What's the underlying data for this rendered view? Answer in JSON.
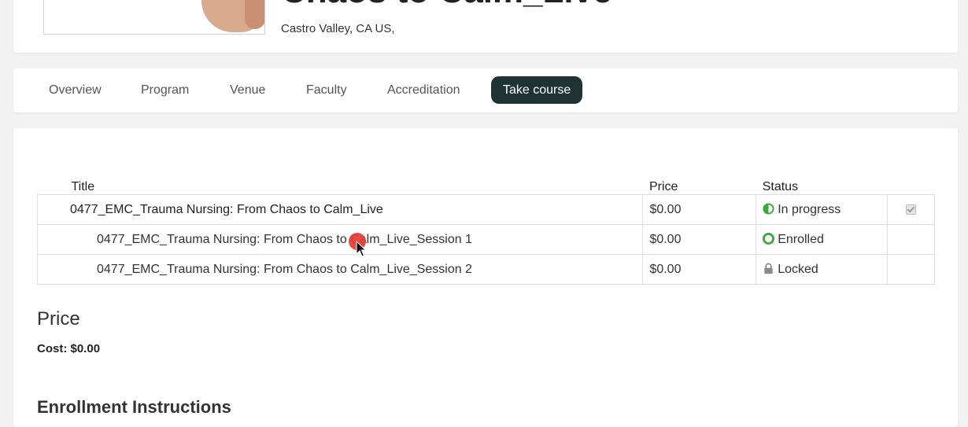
{
  "header": {
    "course_title": "Chaos to Calm_Live",
    "location": "Castro Valley, CA US,"
  },
  "tabs": [
    {
      "label": "Overview",
      "active": false
    },
    {
      "label": "Program",
      "active": false
    },
    {
      "label": "Venue",
      "active": false
    },
    {
      "label": "Faculty",
      "active": false
    },
    {
      "label": "Accreditation",
      "active": false
    },
    {
      "label": "Take course",
      "active": true
    }
  ],
  "table": {
    "headers": {
      "title": "Title",
      "price": "Price",
      "status": "Status"
    },
    "rows": [
      {
        "title": "0477_EMC_Trauma Nursing: From Chaos to Calm_Live",
        "price": "$0.00",
        "status": "In progress",
        "status_icon": "half-circle-icon",
        "checked": true
      },
      {
        "title": "0477_EMC_Trauma Nursing: From Chaos to Calm_Live_Session 1",
        "price": "$0.00",
        "status": "Enrolled",
        "status_icon": "enrolled-circle-icon",
        "checked": false
      },
      {
        "title": "0477_EMC_Trauma Nursing: From Chaos to Calm_Live_Session 2",
        "price": "$0.00",
        "status": "Locked",
        "status_icon": "lock-icon",
        "checked": false
      }
    ]
  },
  "price_section": {
    "heading": "Price",
    "cost_label": "Cost: $0.00"
  },
  "enrollment": {
    "heading": "Enrollment Instructions"
  },
  "colors": {
    "active_tab_bg": "#1f3333",
    "status_green": "#3aa83a",
    "cursor_red": "#e53935"
  }
}
